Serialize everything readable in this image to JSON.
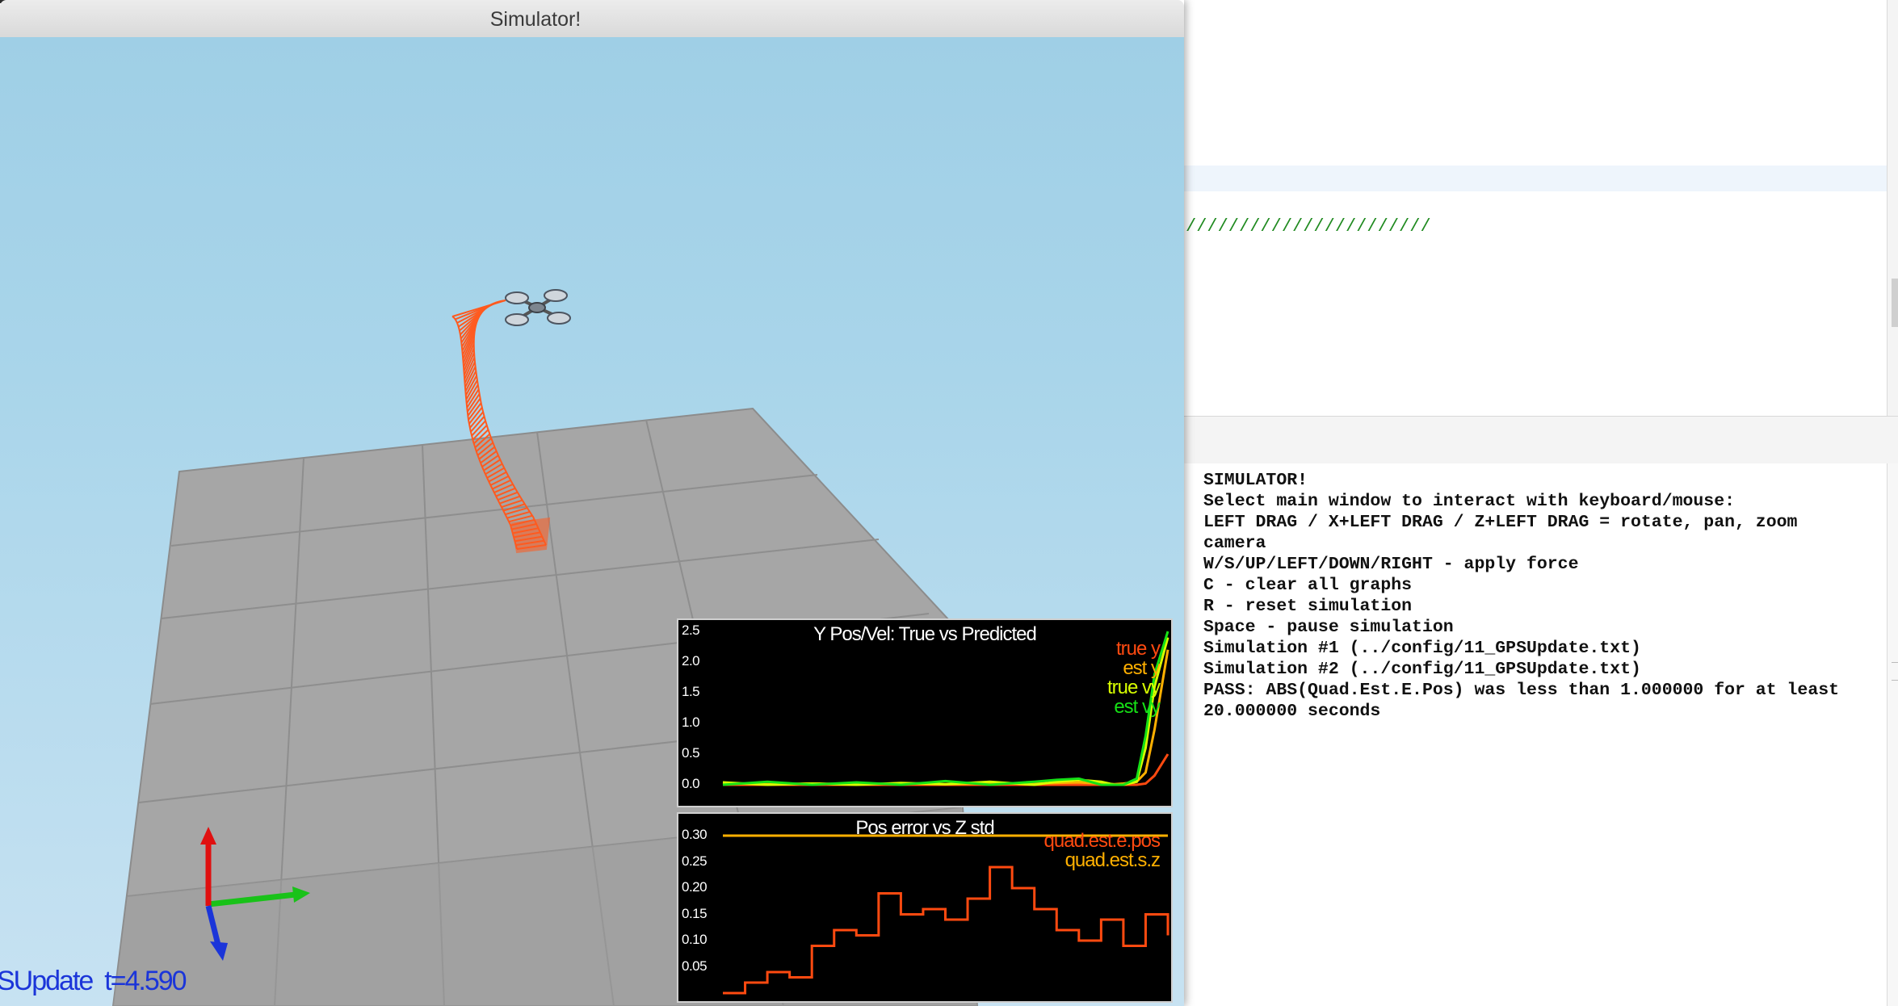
{
  "editor": {
    "comment_line": "///////////////////////"
  },
  "console": {
    "lines": [
      "SIMULATOR!",
      "Select main window to interact with keyboard/mouse:",
      "LEFT DRAG / X+LEFT DRAG / Z+LEFT DRAG = rotate, pan, zoom",
      "camera",
      "W/S/UP/LEFT/DOWN/RIGHT - apply force",
      "C - clear all graphs",
      "R - reset simulation",
      "Space - pause simulation",
      "Simulation #1 (../config/11_GPSUpdate.txt)",
      "Simulation #2 (../config/11_GPSUpdate.txt)",
      "PASS: ABS(Quad.Est.E.Pos) was less than 1.000000 for at least",
      "20.000000 seconds"
    ]
  },
  "simulator": {
    "window_title": "Simulator!",
    "status_text": "SUpdate  t=4.590",
    "axis_colors": {
      "x": "#19c219",
      "y": "#e01010",
      "z": "#1b35d9"
    },
    "trail_color": "#ff5a1f"
  },
  "graph1": {
    "title": "Y Pos/Vel: True vs Predicted",
    "yticks": [
      "2.5",
      "2.0",
      "1.5",
      "1.0",
      "0.5",
      "0.0"
    ],
    "legend": [
      {
        "label": "true y",
        "color": "#ff4a10"
      },
      {
        "label": "est y",
        "color": "#ffb000"
      },
      {
        "label": "true vy",
        "color": "#d8ff00"
      },
      {
        "label": "est vy",
        "color": "#16e016"
      }
    ]
  },
  "graph2": {
    "title": "Pos error vs Z std",
    "yticks": [
      "0.30",
      "0.25",
      "0.20",
      "0.15",
      "0.10",
      "0.05"
    ],
    "legend": [
      {
        "label": "quad.est.e.pos",
        "color": "#ff4a10"
      },
      {
        "label": "quad.est.s.z",
        "color": "#ffb000"
      }
    ]
  },
  "chart_data": [
    {
      "type": "line",
      "title": "Y Pos/Vel: True vs Predicted",
      "ylim": [
        0,
        2.5
      ],
      "x": [
        0,
        0.1,
        0.2,
        0.3,
        0.4,
        0.5,
        0.6,
        0.7,
        0.75,
        0.8,
        0.85,
        0.88,
        0.9,
        0.93,
        0.95,
        0.97,
        1.0
      ],
      "series": [
        {
          "name": "true y",
          "values": [
            0,
            0,
            0,
            0,
            0,
            0,
            0,
            0,
            0,
            0,
            0,
            0,
            0,
            0,
            0.02,
            0.15,
            0.5
          ]
        },
        {
          "name": "est y",
          "values": [
            0.02,
            0.01,
            0.02,
            0.01,
            0.02,
            0.01,
            0.02,
            0.02,
            0.03,
            0.04,
            0.02,
            0.01,
            0.02,
            0.05,
            0.2,
            0.9,
            2.2
          ]
        },
        {
          "name": "true vy",
          "values": [
            0.04,
            0.0,
            0.02,
            -0.03,
            0.03,
            0.01,
            0.05,
            0.0,
            0.05,
            0.08,
            0.05,
            -0.05,
            -0.02,
            0.05,
            0.6,
            1.6,
            2.4
          ]
        },
        {
          "name": "est vy",
          "values": [
            0.0,
            0.05,
            -0.04,
            0.04,
            -0.02,
            0.06,
            -0.03,
            0.05,
            0.08,
            0.1,
            0.0,
            -0.12,
            -0.06,
            0.1,
            0.8,
            1.8,
            2.5
          ]
        }
      ]
    },
    {
      "type": "line",
      "title": "Pos error vs Z std",
      "ylim": [
        0,
        0.32
      ],
      "x": [
        0,
        0.05,
        0.1,
        0.15,
        0.2,
        0.25,
        0.3,
        0.35,
        0.4,
        0.45,
        0.5,
        0.55,
        0.6,
        0.65,
        0.7,
        0.75,
        0.8,
        0.85,
        0.9,
        0.95,
        1.0
      ],
      "series": [
        {
          "name": "quad.est.e.pos",
          "values": [
            0.0,
            0.02,
            0.04,
            0.03,
            0.09,
            0.12,
            0.11,
            0.19,
            0.15,
            0.16,
            0.14,
            0.18,
            0.24,
            0.2,
            0.16,
            0.12,
            0.1,
            0.14,
            0.09,
            0.15,
            0.11
          ]
        },
        {
          "name": "quad.est.s.z",
          "values": [
            0.3,
            0.3,
            0.3,
            0.3,
            0.3,
            0.3,
            0.3,
            0.3,
            0.3,
            0.3,
            0.3,
            0.3,
            0.3,
            0.3,
            0.3,
            0.3,
            0.3,
            0.3,
            0.3,
            0.3,
            0.3
          ]
        }
      ]
    }
  ]
}
